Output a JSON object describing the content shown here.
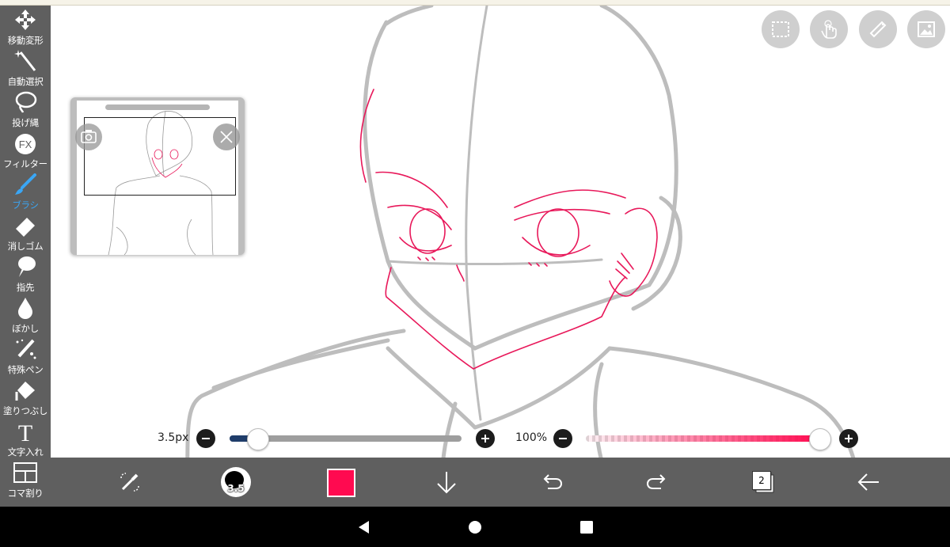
{
  "sidebar": {
    "tools": [
      {
        "label": "移動変形",
        "icon": "move-arrows-icon"
      },
      {
        "label": "自動選択",
        "icon": "magic-wand-icon"
      },
      {
        "label": "投げ縄",
        "icon": "lasso-icon"
      },
      {
        "label": "フィルター",
        "icon": "fx-icon"
      },
      {
        "label": "ブラシ",
        "icon": "brush-icon"
      },
      {
        "label": "消しゴム",
        "icon": "eraser-icon"
      },
      {
        "label": "指先",
        "icon": "finger-smudge-icon"
      },
      {
        "label": "ぼかし",
        "icon": "blur-drop-icon"
      },
      {
        "label": "特殊ペン",
        "icon": "special-pen-icon"
      },
      {
        "label": "塗りつぶし",
        "icon": "fill-bucket-icon"
      },
      {
        "label": "文字入れ",
        "icon": "text-t-icon"
      },
      {
        "label": "コマ割り",
        "icon": "frame-divider-icon"
      }
    ],
    "fx_text": "FX",
    "text_tool_glyph": "T",
    "active_tool": "ブラシ",
    "active_color": "#3aa6f5"
  },
  "top_right_buttons": [
    "selection-icon",
    "hand-gesture-icon",
    "ruler-icon",
    "image-material-icon"
  ],
  "navigator": {
    "camera_icon": "camera-icon",
    "close_icon": "close-icon"
  },
  "brush_size": {
    "text": "3.5px",
    "level": 0.12
  },
  "opacity": {
    "text": "100%",
    "level": 1.0
  },
  "bottom_bar": {
    "brush_preview_value": "3.5",
    "current_color": "#ff0a50",
    "layer_count": "2",
    "icons": [
      "swap-tool-icon",
      "brush-size-icon",
      "color-swatch-icon",
      "arrow-down-icon",
      "undo-icon",
      "redo-icon",
      "layers-icon",
      "back-arrow-icon"
    ]
  },
  "system_nav": {
    "icons": [
      "back-triangle-icon",
      "home-circle-icon",
      "recents-square-icon"
    ]
  }
}
